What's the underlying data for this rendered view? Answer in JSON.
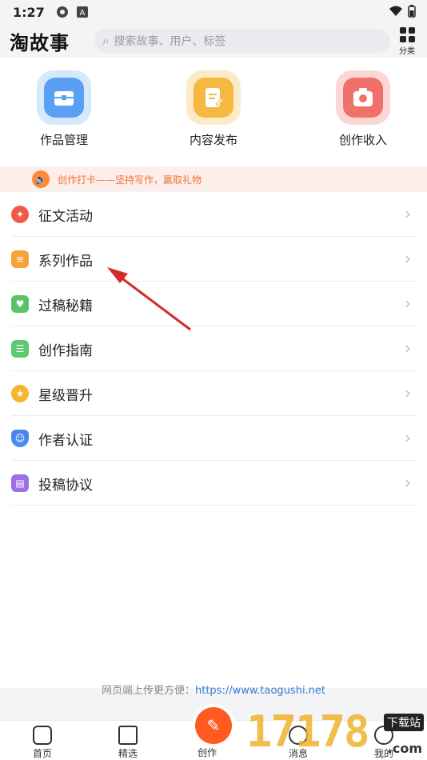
{
  "status_bar": {
    "time": "1:27"
  },
  "header": {
    "logo": "淘故事",
    "search_placeholder": "搜索故事、用户、标签",
    "category_label": "分类"
  },
  "quick_actions": [
    {
      "label": "作品管理",
      "icon": "briefcase-icon",
      "color": "#5aa0f2"
    },
    {
      "label": "内容发布",
      "icon": "edit-document-icon",
      "color": "#f5b840"
    },
    {
      "label": "创作收入",
      "icon": "income-icon",
      "color": "#f0706a"
    }
  ],
  "notice": {
    "text": "创作打卡——坚持写作，赢取礼物"
  },
  "menu": [
    {
      "label": "征文活动",
      "icon": "flame-icon",
      "color": "#ef5b4a"
    },
    {
      "label": "系列作品",
      "icon": "series-icon",
      "color": "#f3a53a"
    },
    {
      "label": "过稿秘籍",
      "icon": "manual-icon",
      "color": "#58c46a"
    },
    {
      "label": "创作指南",
      "icon": "guide-icon",
      "color": "#5ec86e"
    },
    {
      "label": "星级晋升",
      "icon": "star-icon",
      "color": "#f7b52c"
    },
    {
      "label": "作者认证",
      "icon": "shield-user-icon",
      "color": "#4a88ef"
    },
    {
      "label": "投稿协议",
      "icon": "agreement-icon",
      "color": "#9c6ee8"
    }
  ],
  "footer": {
    "prefix": "网页端上传更方便：",
    "url": "https://www.taogushi.net"
  },
  "tabbar": {
    "tabs": [
      "首页",
      "精选",
      "创作",
      "消息",
      "我的"
    ]
  },
  "watermark": {
    "digits": "17178",
    "site": "下载站",
    "com": ".com"
  }
}
